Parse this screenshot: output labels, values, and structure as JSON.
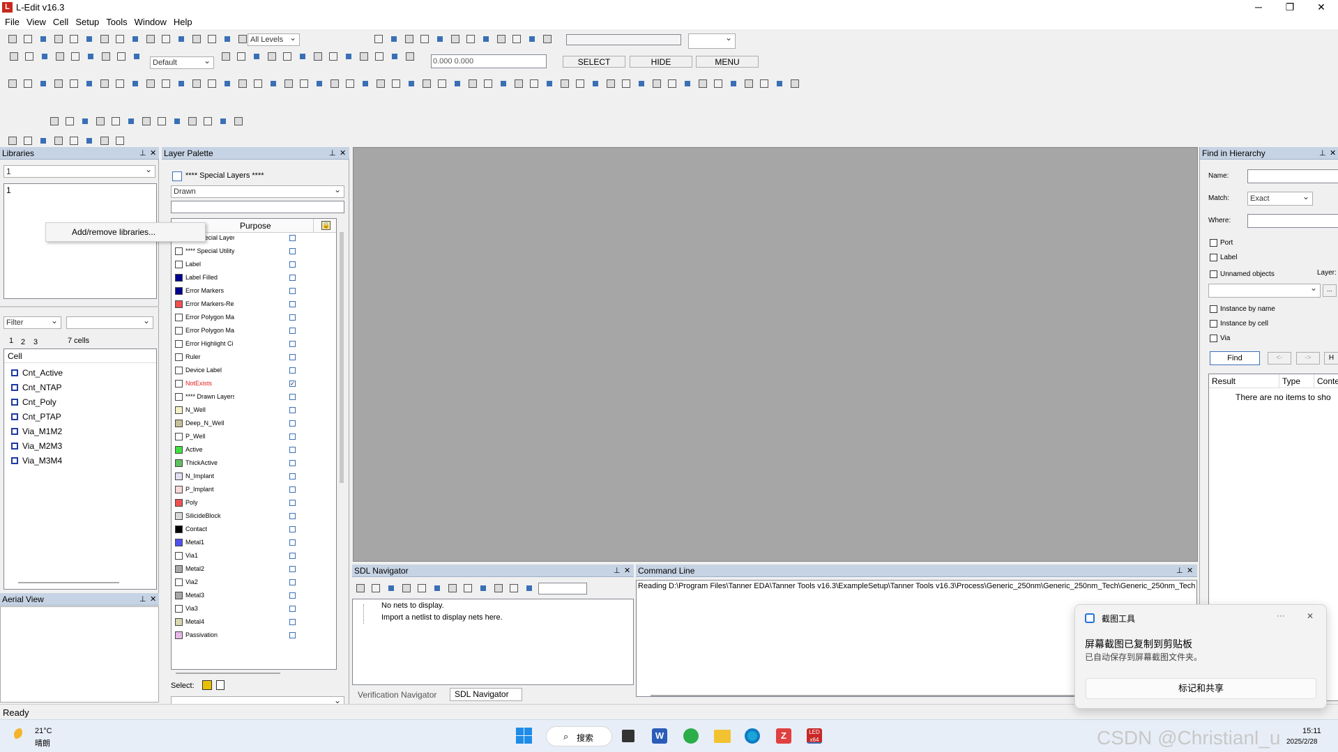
{
  "window": {
    "title": "L-Edit v16.3",
    "min": "─",
    "max": "❐",
    "close": "✕"
  },
  "menu": [
    "File",
    "View",
    "Cell",
    "Setup",
    "Tools",
    "Window",
    "Help"
  ],
  "toolbar": {
    "levels": "All Levels",
    "default_combo": "Default",
    "coords": "0.000 0.000",
    "select": "SELECT",
    "hide": "HIDE",
    "menu_btn": "MENU"
  },
  "libraries": {
    "title": "Libraries",
    "selected": "1",
    "list_item": "1",
    "context_menu": "Add/remove libraries...",
    "filter": "Filter",
    "tabs": [
      "1",
      "2",
      "3"
    ],
    "count": "7 cells",
    "col_header": "Cell",
    "cells": [
      "Cnt_Active",
      "Cnt_NTAP",
      "Cnt_Poly",
      "Cnt_PTAP",
      "Via_M1M2",
      "Via_M2M3",
      "Via_M3M4"
    ]
  },
  "aerial": {
    "title": "Aerial View"
  },
  "layer_palette": {
    "title": "Layer Palette",
    "special": "**** Special Layers ****",
    "mode": "Drawn",
    "purpose_header": "Purpose",
    "select_label": "Select:",
    "layers": [
      {
        "name": "**** Special Layer",
        "color": "#ffffff",
        "checked": false
      },
      {
        "name": "**** Special Utility",
        "color": "#ffffff",
        "checked": false
      },
      {
        "name": "Label",
        "color": "#ffffff",
        "checked": false
      },
      {
        "name": "Label Filled",
        "color": "#000090",
        "checked": false
      },
      {
        "name": "Error Markers",
        "color": "#000090",
        "checked": false
      },
      {
        "name": "Error Markers-Rec",
        "color": "#f05050",
        "checked": false
      },
      {
        "name": "Error Polygon Ma",
        "color": "#ffffff",
        "checked": false
      },
      {
        "name": "Error Polygon Ma",
        "color": "#ffffff",
        "checked": false
      },
      {
        "name": "Error Highlight Ci",
        "color": "#ffffff",
        "checked": false
      },
      {
        "name": "Ruler",
        "color": "#ffffff",
        "checked": false
      },
      {
        "name": "Device Label",
        "color": "#ffffff",
        "checked": false
      },
      {
        "name": "NotExists",
        "color": "#ffffff",
        "checked": true,
        "red": true
      },
      {
        "name": "**** Drawn Layers",
        "color": "#ffffff",
        "checked": false
      },
      {
        "name": "N_Well",
        "color": "#f4f0c8",
        "checked": false
      },
      {
        "name": "Deep_N_Well",
        "color": "#c8c098",
        "checked": false
      },
      {
        "name": "P_Well",
        "color": "#ffffff",
        "checked": false
      },
      {
        "name": "Active",
        "color": "#40e040",
        "checked": false
      },
      {
        "name": "ThickActive",
        "color": "#60c060",
        "checked": false
      },
      {
        "name": "N_Implant",
        "color": "#e0e0f0",
        "checked": false
      },
      {
        "name": "P_Implant",
        "color": "#f8d8d8",
        "checked": false
      },
      {
        "name": "Poly",
        "color": "#f05050",
        "checked": false
      },
      {
        "name": "SilicideBlock",
        "color": "#d8d8d8",
        "checked": false
      },
      {
        "name": "Contact",
        "color": "#000000",
        "checked": false
      },
      {
        "name": "Metal1",
        "color": "#5050f0",
        "checked": false
      },
      {
        "name": "Via1",
        "color": "#ffffff",
        "checked": false
      },
      {
        "name": "Metal2",
        "color": "#a8a8a8",
        "checked": false
      },
      {
        "name": "Via2",
        "color": "#ffffff",
        "checked": false
      },
      {
        "name": "Metal3",
        "color": "#a8a8a8",
        "checked": false
      },
      {
        "name": "Via3",
        "color": "#ffffff",
        "checked": false
      },
      {
        "name": "Metal4",
        "color": "#d8d8b0",
        "checked": false
      },
      {
        "name": "Passivation",
        "color": "#e8b8e8",
        "checked": false
      }
    ]
  },
  "sdl": {
    "title": "SDL Navigator",
    "line1": "No nets to display.",
    "line2": "Import a netlist to display nets here.",
    "tab1": "Verification Navigator",
    "tab2": "SDL Navigator"
  },
  "cmd": {
    "title": "Command Line",
    "text": "Reading D:\\Program Files\\Tanner EDA\\Tanner Tools v16.3\\ExampleSetup\\Tanner Tools v16.3\\Process\\Generic_250nm\\Generic_250nm_Tech\\Generic_250nm_Tech"
  },
  "find": {
    "title": "Find in Hierarchy",
    "name": "Name:",
    "match": "Match:",
    "match_val": "Exact",
    "where": "Where:",
    "port": "Port",
    "label": "Label",
    "unnamed": "Unnamed objects",
    "layer": "Layer:",
    "inst_name": "Instance by name",
    "inst_cell": "Instance by cell",
    "via": "Via",
    "find_btn": "Find",
    "prev": "<-",
    "next": "->",
    "h": "H",
    "cols": [
      "Result",
      "Type",
      "Conte"
    ],
    "empty": "There are no items to sho"
  },
  "toast": {
    "app": "截图工具",
    "more": "···",
    "close": "✕",
    "line1": "屏幕截图已复制到剪贴板",
    "line2": "已自动保存到屏幕截图文件夹。",
    "action": "标记和共享"
  },
  "status": {
    "text": "Ready"
  },
  "taskbar": {
    "temp": "21°C",
    "weather": "晴朗",
    "search": "搜索",
    "time": "15:11",
    "date": "2025/2/28",
    "watermark": "CSDN @Christianl_u"
  },
  "colors": {
    "canvas": "#a6a6a6",
    "panel_header": "#c6d3e4",
    "accent": "#3a6fb5"
  }
}
